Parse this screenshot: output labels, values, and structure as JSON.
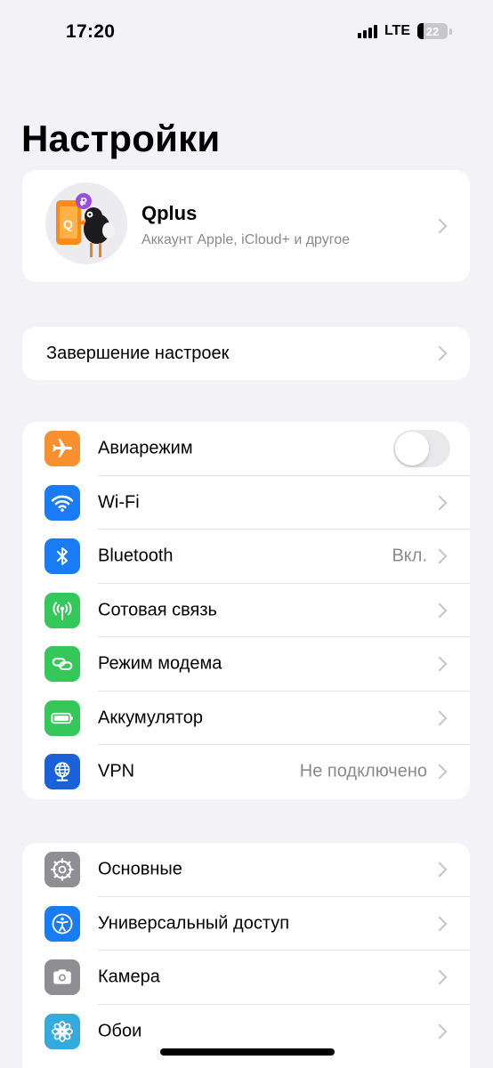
{
  "status_bar": {
    "time": "17:20",
    "network": "LTE",
    "battery_level": "22",
    "battery_fraction": 0.22
  },
  "title": "Настройки",
  "profile": {
    "name": "Qplus",
    "subtitle": "Аккаунт Apple, iCloud+ и другое",
    "avatar_icon": "qplus-bird-avatar-icon"
  },
  "setup": {
    "label": "Завершение настроек"
  },
  "network_group": [
    {
      "label": "Авиарежим",
      "icon": "airplane-icon",
      "color": "#f7902d",
      "toggle": false
    },
    {
      "label": "Wi-Fi",
      "icon": "wifi-icon",
      "color": "#1a7cf5"
    },
    {
      "label": "Bluetooth",
      "icon": "bluetooth-icon",
      "color": "#1a7cf5",
      "value": "Вкл."
    },
    {
      "label": "Сотовая связь",
      "icon": "antenna-icon",
      "color": "#34c759"
    },
    {
      "label": "Режим модема",
      "icon": "chain-link-icon",
      "color": "#34c759"
    },
    {
      "label": "Аккумулятор",
      "icon": "battery-icon",
      "color": "#34c759"
    },
    {
      "label": "VPN",
      "icon": "globe-icon",
      "color": "#1a60d6",
      "value": "Не подключено"
    }
  ],
  "general_group": [
    {
      "label": "Основные",
      "icon": "gear-icon",
      "color": "#8e8e93"
    },
    {
      "label": "Универсальный доступ",
      "icon": "accessibility-icon",
      "color": "#1a7cf5"
    },
    {
      "label": "Камера",
      "icon": "camera-icon",
      "color": "#8e8e93"
    },
    {
      "label": "Обои",
      "icon": "wallpaper-flower-icon",
      "color": "#35aadc"
    }
  ]
}
